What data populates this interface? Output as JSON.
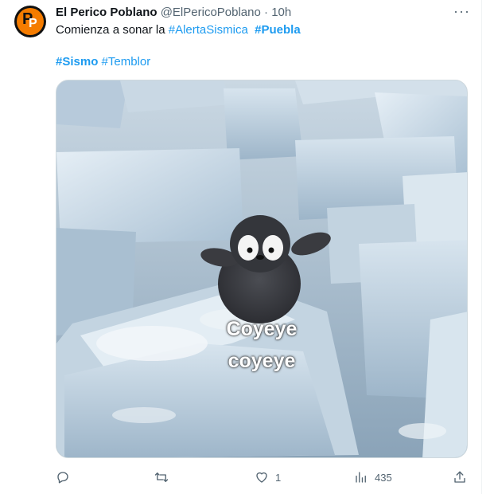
{
  "tweet": {
    "author_name": "El Perico Poblano",
    "author_handle": "@ElPericoPoblano",
    "separator": "·",
    "time": "10h",
    "text_start": "Comienza a sonar la ",
    "hashtags_line1": [
      "#AlertaSismica",
      "#Puebla"
    ],
    "hashtags_line2": [
      "#Sismo",
      "#Temblor"
    ],
    "media_caption_line1": "Coyeye",
    "media_caption_line2": "coyeye",
    "more_label": "···"
  },
  "actions": {
    "reply_count": "",
    "retweet_count": "",
    "like_count": "1",
    "views_count": "435"
  },
  "icons": [
    "reply-icon",
    "retweet-icon",
    "like-icon",
    "views-icon",
    "share-icon",
    "more-icon"
  ],
  "colors": {
    "link": "#1d9bf0",
    "secondary": "#536471",
    "text": "#0f1419"
  }
}
